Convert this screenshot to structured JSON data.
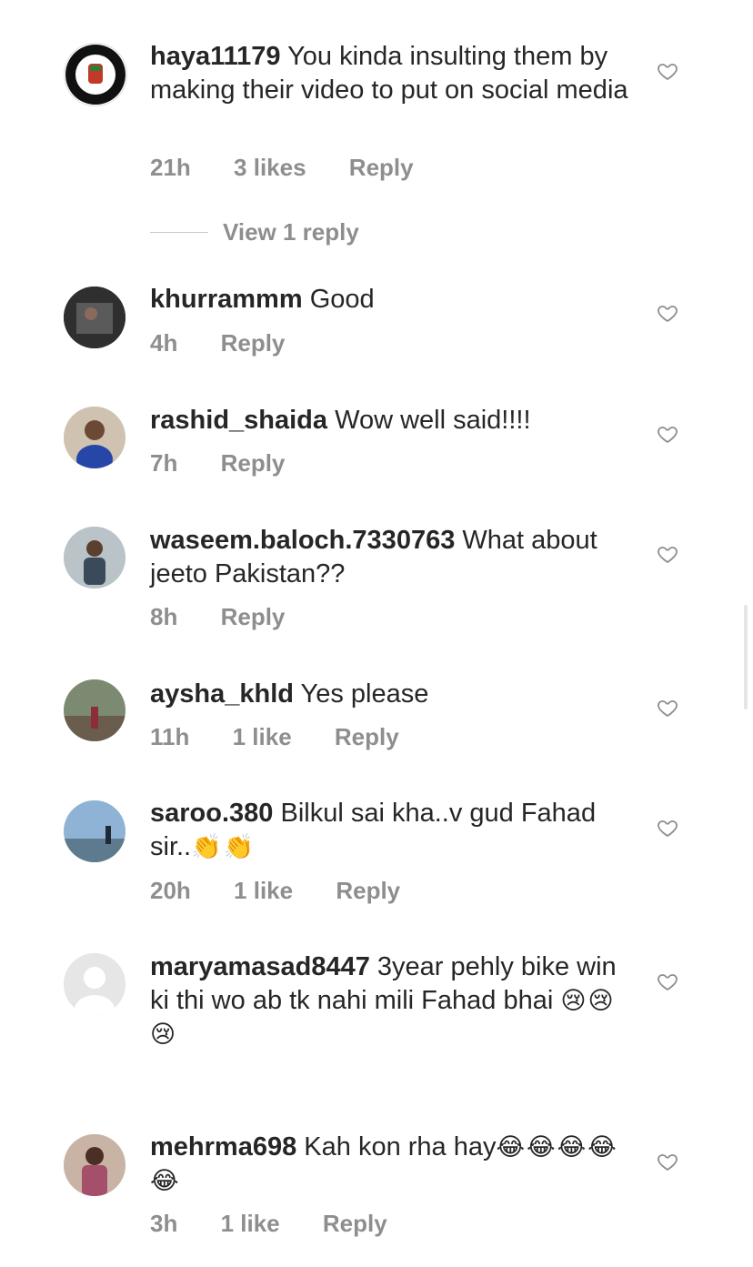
{
  "colors": {
    "text": "#262626",
    "meta": "#8e8e8e",
    "heart_stroke": "#8e8e8e",
    "divider": "#c7c7c7"
  },
  "comments": [
    {
      "username": "haya11179",
      "text": "You kinda insulting them by making their video to put on social media",
      "time": "21h",
      "likes": "3 likes",
      "reply": "Reply",
      "view_replies": "View 1 reply"
    },
    {
      "username": "khurrammm",
      "text": "Good",
      "time": "4h",
      "reply": "Reply"
    },
    {
      "username": "rashid_shaida",
      "text": "Wow well said!!!!",
      "time": "7h",
      "reply": "Reply"
    },
    {
      "username": "waseem.baloch.7330763",
      "text": "What about jeeto Pakistan??",
      "time": "8h",
      "reply": "Reply"
    },
    {
      "username": "aysha_khld",
      "text": "Yes please",
      "time": "11h",
      "likes": "1 like",
      "reply": "Reply"
    },
    {
      "username": "saroo.380",
      "text": "Bilkul sai kha..v gud Fahad sir..",
      "emoji": "👏👏",
      "time": "20h",
      "likes": "1 like",
      "reply": "Reply"
    },
    {
      "username": "maryamasad8447",
      "text": "3year pehly bike win ki thi wo ab tk nahi mili Fahad bhai",
      "emoji": "😢😢😢"
    },
    {
      "username": "mehrma698",
      "text": "Kah kon rha hay",
      "emoji": "😂😂😂😂😂",
      "time": "3h",
      "likes": "1 like",
      "reply": "Reply"
    }
  ]
}
